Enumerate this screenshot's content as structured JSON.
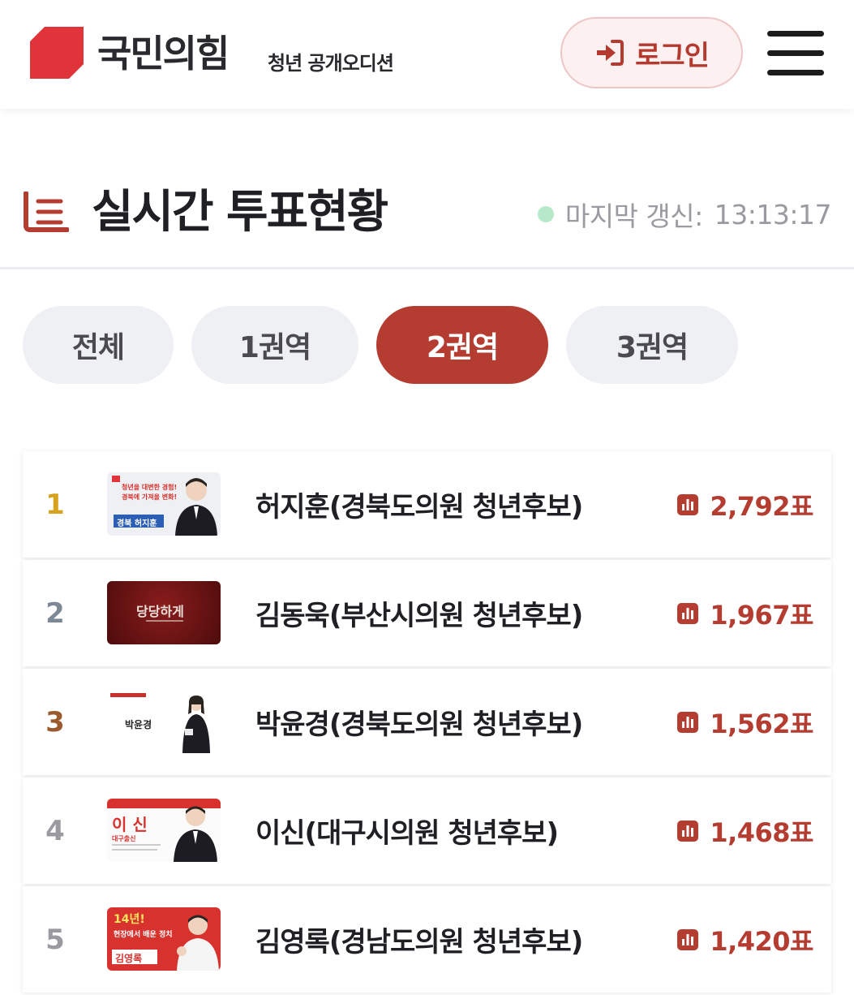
{
  "header": {
    "brand": "국민의힘",
    "brand_sub": "청년 공개오디션",
    "login_label": "로그인"
  },
  "section": {
    "title": "실시간 투표현황",
    "update_label": "마지막 갱신:",
    "update_time": "13:13:17"
  },
  "tabs": [
    {
      "label": "전체",
      "active": false
    },
    {
      "label": "1권역",
      "active": false
    },
    {
      "label": "2권역",
      "active": true
    },
    {
      "label": "3권역",
      "active": false
    }
  ],
  "candidates": [
    {
      "rank": "1",
      "name": "허지훈(경북도의원 청년후보)",
      "votes": "2,792표",
      "rank_color": "#d7a21d",
      "thumb_lines": [
        "청년을 대변한 경험!",
        "경북에 가져올 변화!",
        "경북 허지훈"
      ]
    },
    {
      "rank": "2",
      "name": "김동욱(부산시의원 청년후보)",
      "votes": "1,967표",
      "rank_color": "#7d8896",
      "thumb_lines": [
        "당당하게"
      ]
    },
    {
      "rank": "3",
      "name": "박윤경(경북도의원 청년후보)",
      "votes": "1,562표",
      "rank_color": "#9a5a2c",
      "thumb_lines": [
        "박윤경"
      ]
    },
    {
      "rank": "4",
      "name": "이신(대구시의원 청년후보)",
      "votes": "1,468표",
      "rank_color": "#9a9aa0",
      "thumb_lines": [
        "이 신",
        "대구출신"
      ]
    },
    {
      "rank": "5",
      "name": "김영록(경남도의원 청년후보)",
      "votes": "1,420표",
      "rank_color": "#9a9aa0",
      "thumb_lines": [
        "14년!",
        "현장에서 배운 정치",
        "김영록"
      ]
    }
  ],
  "colors": {
    "accent": "#b53c31",
    "brand_red": "#e0333a"
  }
}
